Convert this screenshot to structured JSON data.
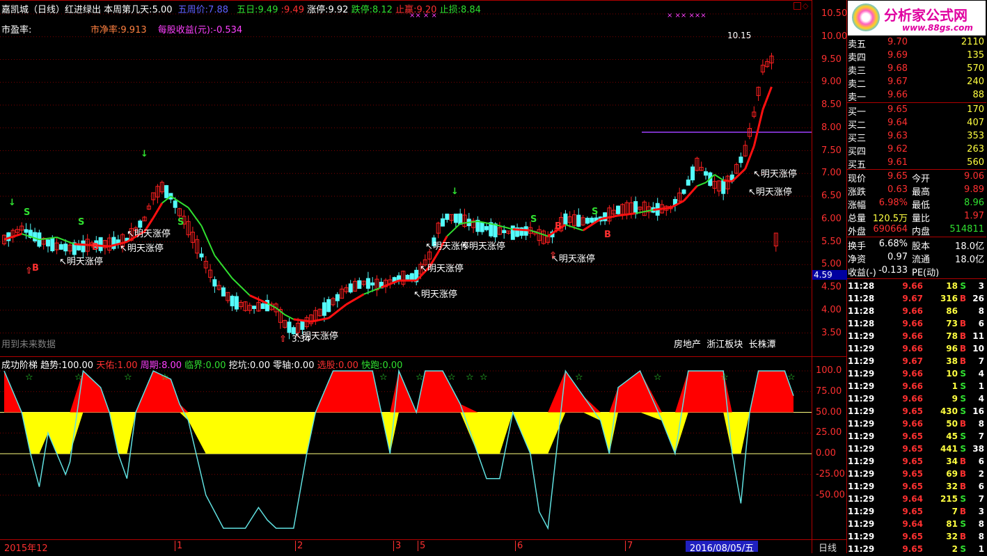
{
  "header": {
    "stock_name": "嘉凯城（日线）",
    "indicator_name": "红进绿出",
    "week_day_label": "本周第几天:",
    "week_day_value": "5.00",
    "five_week_label": "五周价:",
    "five_week_value": "7.88",
    "five_day_label": "五日:",
    "five_day_value1": "9.49",
    "five_day_value2": "9.49",
    "limit_up_label": "涨停:",
    "limit_up_value": "9.92",
    "limit_down_label": "跌停:",
    "limit_down_value": "8.12",
    "take_profit_label": "止赢:",
    "take_profit_value": "9.20",
    "stop_loss_label": "止损:",
    "stop_loss_value": "8.84",
    "pe_label": "市盈率:",
    "pb_label": "市净率:",
    "pb_value": "9.913",
    "eps_label": "每股收益(元):",
    "eps_value": "-0.534",
    "x_markers": "×× ×  ×",
    "x_markers2": "× ××   ×××",
    "future_data_hint": "用到未来数据",
    "peak_label": "10.15",
    "low_label": "3.34",
    "sectors": [
      "房地产",
      "浙江板块",
      "长株潭"
    ]
  },
  "annotations": [
    "明天涨停",
    "明天涨停",
    "明天涨停",
    "明天涨停",
    "明天涨停",
    "明天涨停",
    "明天涨停",
    "明天涨停",
    "明天涨停",
    "明天涨停",
    "明天涨停"
  ],
  "signals": {
    "buy": "B",
    "sell": "S"
  },
  "main_axis": {
    "ticks": [
      "10.50",
      "10.00",
      "9.50",
      "9.00",
      "8.50",
      "8.00",
      "7.50",
      "7.00",
      "6.50",
      "6.00",
      "5.50",
      "5.00",
      "4.50",
      "4.00",
      "3.50"
    ],
    "cursor_value": "4.59"
  },
  "indicator_panel": {
    "name": "成功阶梯",
    "trend_label": "趋势:",
    "trend_value": "100.00",
    "tianyou_label": "天佑:",
    "tianyou_value": "1.00",
    "period_label": "周期:",
    "period_value": "8.00",
    "critical_label": "临界:",
    "critical_value": "0.00",
    "dig_label": "挖坑:",
    "dig_value": "0.00",
    "zero_label": "零轴:",
    "zero_value": "0.00",
    "select_label": "选股:",
    "select_value": "0.00",
    "fast_label": "快跑:",
    "fast_value": "0.00",
    "ticks": [
      "100.0",
      "75.00",
      "50.00",
      "25.00",
      "0.00",
      "-25.00",
      "-50.00"
    ]
  },
  "time_axis": {
    "labels": [
      "2015年12",
      "1",
      "2",
      "3",
      "5",
      "6",
      "7"
    ],
    "current_date": "2016/08/05/五",
    "period": "日线"
  },
  "logo": {
    "text": "分析家公式网",
    "url": "www.88gs.com"
  },
  "order_book": {
    "asks": [
      {
        "label": "卖五",
        "price": "9.70",
        "vol": "2110"
      },
      {
        "label": "卖四",
        "price": "9.69",
        "vol": "135"
      },
      {
        "label": "卖三",
        "price": "9.68",
        "vol": "570"
      },
      {
        "label": "卖二",
        "price": "9.67",
        "vol": "240"
      },
      {
        "label": "卖一",
        "price": "9.66",
        "vol": "88"
      }
    ],
    "bids": [
      {
        "label": "买一",
        "price": "9.65",
        "vol": "170"
      },
      {
        "label": "买二",
        "price": "9.64",
        "vol": "407"
      },
      {
        "label": "买三",
        "price": "9.63",
        "vol": "353"
      },
      {
        "label": "买四",
        "price": "9.62",
        "vol": "263"
      },
      {
        "label": "买五",
        "price": "9.61",
        "vol": "560"
      }
    ]
  },
  "quote": {
    "price_label": "现价",
    "price": "9.65",
    "open_label": "今开",
    "open": "9.06",
    "change_label": "涨跌",
    "change": "0.63",
    "high_label": "最高",
    "high": "9.89",
    "pct_label": "涨幅",
    "pct": "6.98%",
    "low_label": "最低",
    "low": "8.96",
    "volume_label": "总量",
    "volume": "120.5万",
    "ratio_label": "量比",
    "ratio": "1.97",
    "outer_label": "外盘",
    "outer": "690664",
    "inner_label": "内盘",
    "inner": "514811",
    "turnover_label": "换手",
    "turnover": "6.68%",
    "equity_label": "股本",
    "equity": "18.0亿",
    "nav_label": "净资",
    "nav": "0.97",
    "float_label": "流通",
    "float": "18.0亿",
    "eps_label": "收益(-)",
    "eps": "-0.133",
    "pe_label": "PE(动)",
    "pe": ""
  },
  "trades": [
    {
      "t": "11:28",
      "p": "9.66",
      "v": "18",
      "d": "S",
      "n": "3"
    },
    {
      "t": "11:28",
      "p": "9.67",
      "v": "316",
      "d": "B",
      "n": "26"
    },
    {
      "t": "11:28",
      "p": "9.66",
      "v": "86",
      "d": "",
      "n": "8"
    },
    {
      "t": "11:28",
      "p": "9.66",
      "v": "73",
      "d": "B",
      "n": "6"
    },
    {
      "t": "11:29",
      "p": "9.66",
      "v": "78",
      "d": "B",
      "n": "11"
    },
    {
      "t": "11:29",
      "p": "9.66",
      "v": "96",
      "d": "B",
      "n": "10"
    },
    {
      "t": "11:29",
      "p": "9.67",
      "v": "38",
      "d": "B",
      "n": "7"
    },
    {
      "t": "11:29",
      "p": "9.66",
      "v": "10",
      "d": "S",
      "n": "4"
    },
    {
      "t": "11:29",
      "p": "9.66",
      "v": "1",
      "d": "S",
      "n": "1"
    },
    {
      "t": "11:29",
      "p": "9.66",
      "v": "9",
      "d": "S",
      "n": "4"
    },
    {
      "t": "11:29",
      "p": "9.65",
      "v": "430",
      "d": "S",
      "n": "16"
    },
    {
      "t": "11:29",
      "p": "9.66",
      "v": "50",
      "d": "B",
      "n": "8"
    },
    {
      "t": "11:29",
      "p": "9.65",
      "v": "45",
      "d": "S",
      "n": "7"
    },
    {
      "t": "11:29",
      "p": "9.65",
      "v": "441",
      "d": "S",
      "n": "38"
    },
    {
      "t": "11:29",
      "p": "9.65",
      "v": "34",
      "d": "B",
      "n": "6"
    },
    {
      "t": "11:29",
      "p": "9.65",
      "v": "69",
      "d": "B",
      "n": "2"
    },
    {
      "t": "11:29",
      "p": "9.65",
      "v": "32",
      "d": "B",
      "n": "6"
    },
    {
      "t": "11:29",
      "p": "9.64",
      "v": "215",
      "d": "S",
      "n": "7"
    },
    {
      "t": "11:29",
      "p": "9.65",
      "v": "7",
      "d": "B",
      "n": "3"
    },
    {
      "t": "11:29",
      "p": "9.64",
      "v": "81",
      "d": "S",
      "n": "8"
    },
    {
      "t": "11:29",
      "p": "9.65",
      "v": "32",
      "d": "B",
      "n": "8"
    },
    {
      "t": "11:29",
      "p": "9.65",
      "v": "2",
      "d": "S",
      "n": "1"
    }
  ],
  "colors": {
    "up": "#ff2020",
    "down": "#54fcfc",
    "ma_green": "#30e030",
    "ma_red": "#ff1010",
    "grid": "#b00000",
    "yellow": "#ffff00"
  }
}
